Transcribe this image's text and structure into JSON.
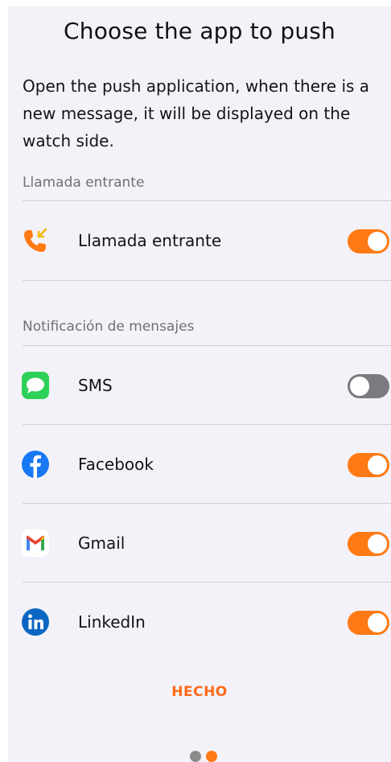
{
  "title": "Choose the app to push",
  "description": "Open the push application, when there is a new message, it will be displayed on the watch side.",
  "sections": {
    "calls": {
      "label": "Llamada entrante",
      "items": [
        {
          "label": "Llamada entrante",
          "icon": "incoming-call-icon",
          "enabled": true
        }
      ]
    },
    "messages": {
      "label": "Notificación de mensajes",
      "items": [
        {
          "label": "SMS",
          "icon": "sms-icon",
          "enabled": false
        },
        {
          "label": "Facebook",
          "icon": "facebook-icon",
          "enabled": true
        },
        {
          "label": "Gmail",
          "icon": "gmail-icon",
          "enabled": true
        },
        {
          "label": "LinkedIn",
          "icon": "linkedin-icon",
          "enabled": true
        }
      ]
    }
  },
  "done_label": "HECHO",
  "pager": {
    "total": 2,
    "current": 2
  },
  "colors": {
    "accent": "#ff7a14",
    "toggle_off": "#7a7a80",
    "background": "#f3f2f9"
  }
}
